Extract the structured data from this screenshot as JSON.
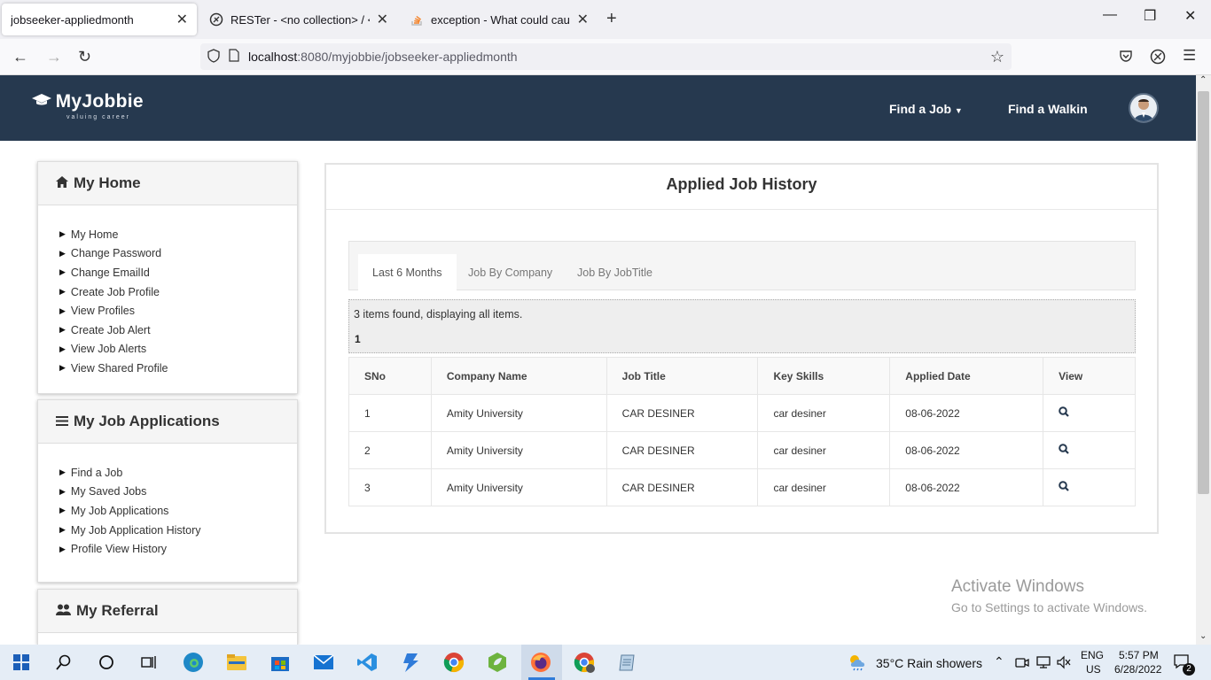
{
  "browser": {
    "tabs": [
      {
        "title": "jobseeker-appliedmonth"
      },
      {
        "title": "RESTer - <no collection> / <no"
      },
      {
        "title": "exception - What could cause ja"
      }
    ],
    "url_host": "localhost",
    "url_path": ":8080/myjobbie/jobseeker-appliedmonth"
  },
  "site": {
    "logo_name": "MyJobbie",
    "logo_tagline": "valuing career",
    "menu": {
      "find_job": "Find a Job",
      "find_walkin": "Find a Walkin"
    }
  },
  "sidebar": {
    "home": {
      "title": "My Home",
      "items": [
        "My Home",
        "Change Password",
        "Change EmailId",
        "Create Job Profile",
        "View Profiles",
        "Create Job Alert",
        "View Job Alerts",
        "View Shared Profile"
      ]
    },
    "applications": {
      "title": "My Job Applications",
      "items": [
        "Find a Job",
        "My Saved Jobs",
        "My Job Applications",
        "My Job Application History",
        "Profile View History"
      ]
    },
    "referral": {
      "title": "My Referral"
    }
  },
  "main": {
    "title": "Applied Job History",
    "tabs": [
      "Last 6 Months",
      "Job By Company",
      "Job By JobTitle"
    ],
    "info": "3 items found, displaying all items.",
    "page": "1",
    "columns": [
      "SNo",
      "Company Name",
      "Job Title",
      "Key Skills",
      "Applied Date",
      "View"
    ],
    "rows": [
      [
        "1",
        "Amity University",
        "CAR DESINER",
        "car desiner",
        "08-06-2022"
      ],
      [
        "2",
        "Amity University",
        "CAR DESINER",
        "car desiner",
        "08-06-2022"
      ],
      [
        "3",
        "Amity University",
        "CAR DESINER",
        "car desiner",
        "08-06-2022"
      ]
    ]
  },
  "watermark": {
    "line1": "Activate Windows",
    "line2": "Go to Settings to activate Windows."
  },
  "taskbar": {
    "weather": "35°C  Rain showers",
    "lang1": "ENG",
    "lang2": "US",
    "time": "5:57 PM",
    "date": "6/28/2022",
    "notifications": "2"
  },
  "colors": {
    "header_bg": "#26394f",
    "accent": "#2f7bd9"
  }
}
